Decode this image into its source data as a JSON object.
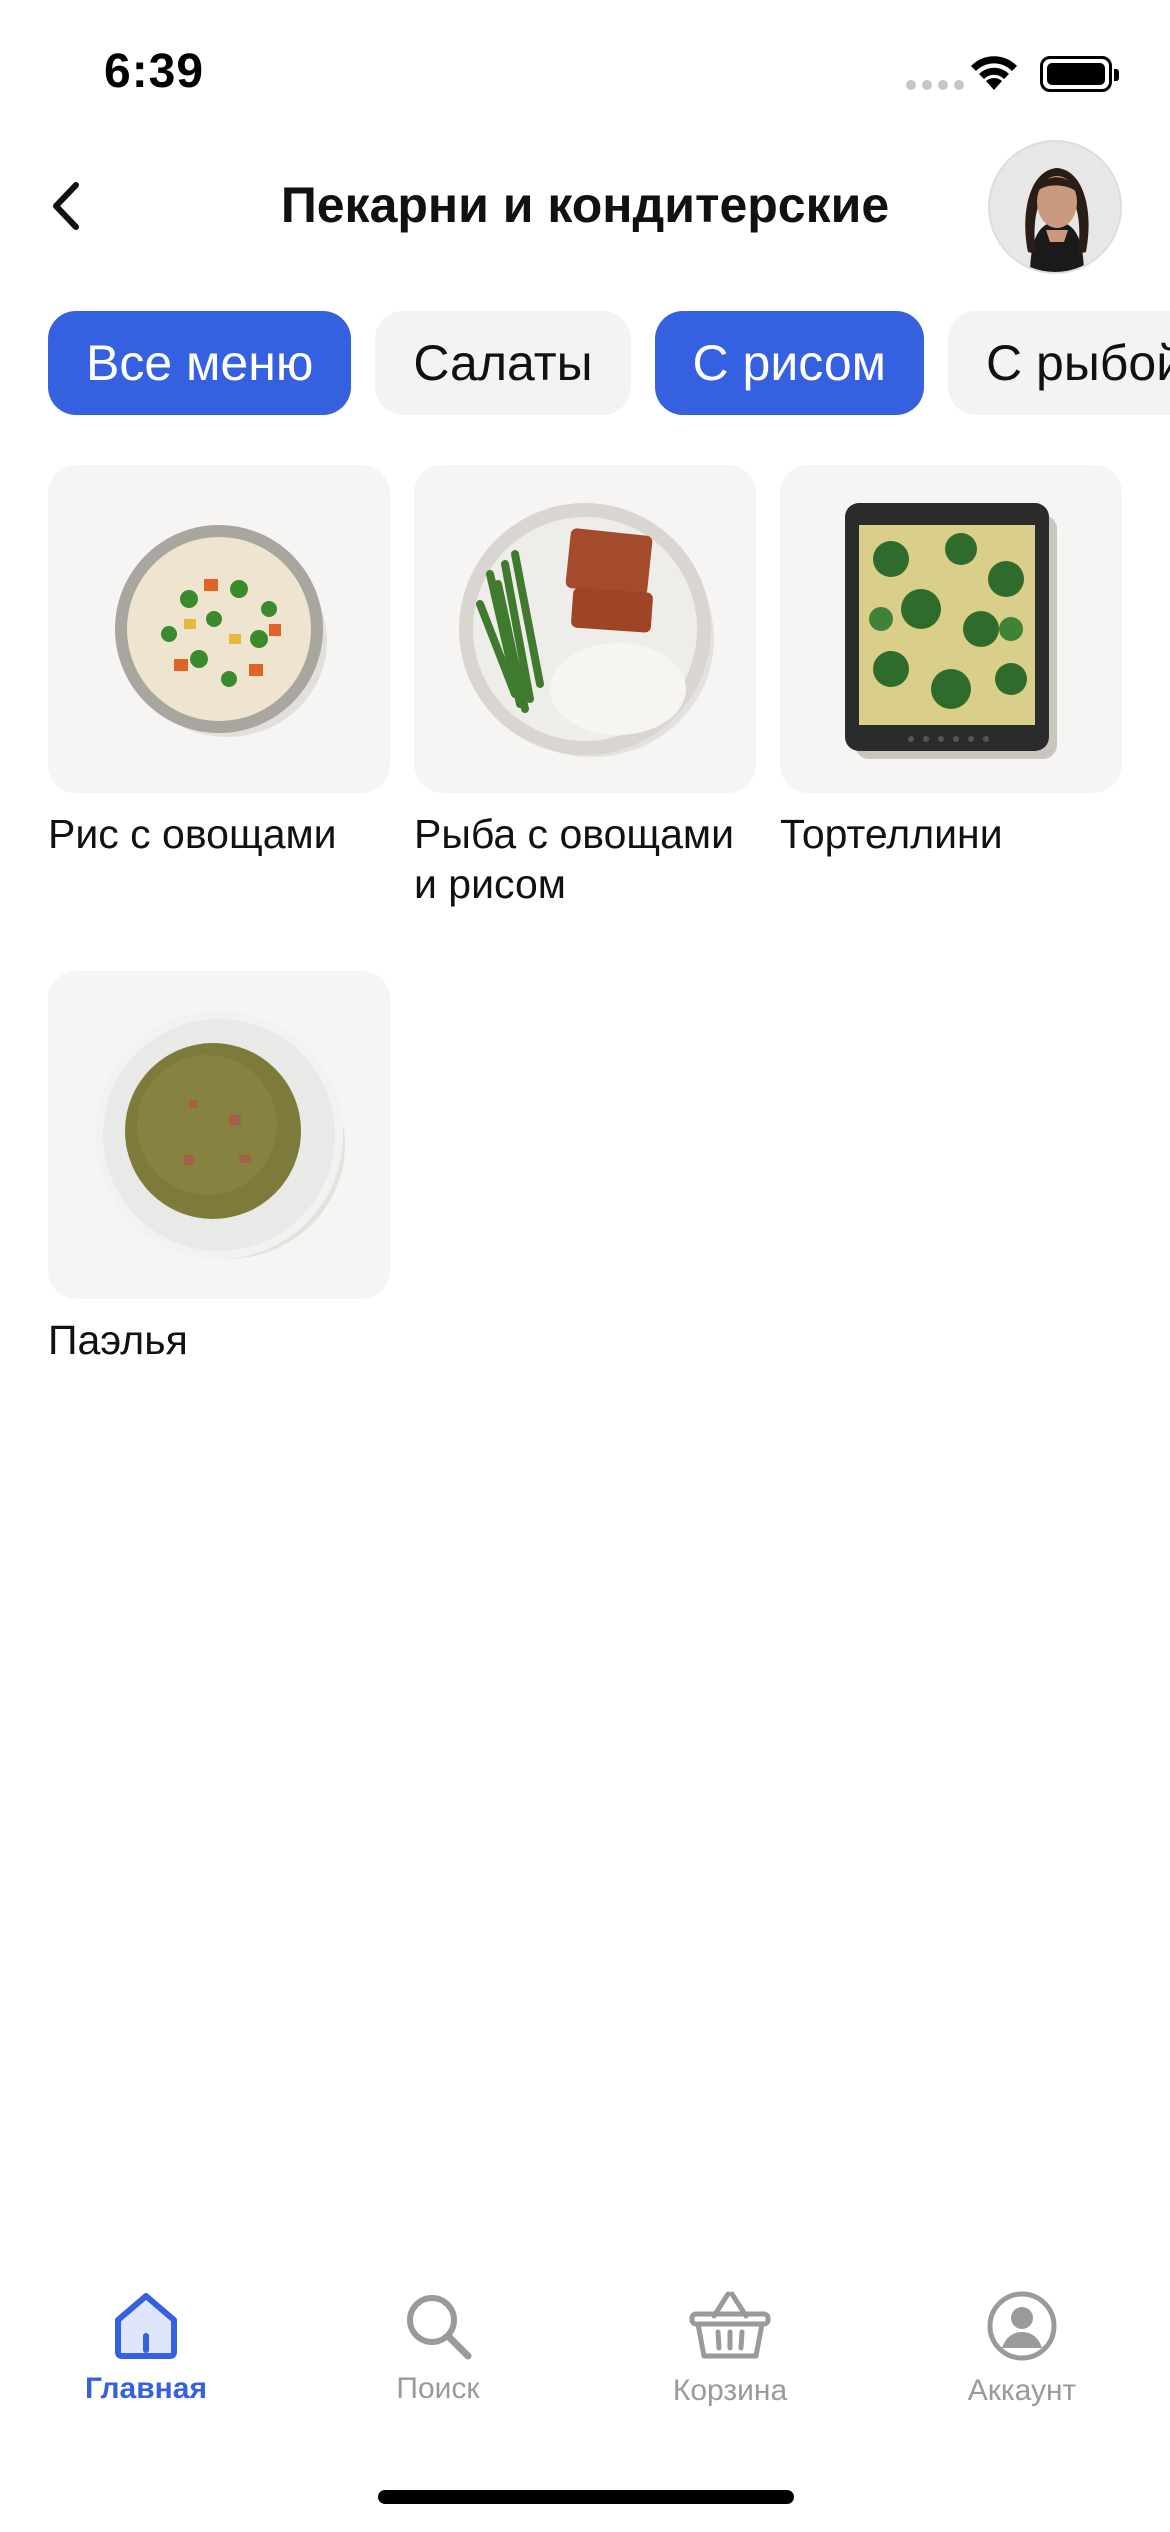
{
  "status": {
    "time": "6:39"
  },
  "header": {
    "title": "Пекарни и кондитерские"
  },
  "chips": [
    {
      "label": "Все меню",
      "active": true
    },
    {
      "label": "Салаты",
      "active": false
    },
    {
      "label": "С рисом",
      "active": true
    },
    {
      "label": "С рыбой",
      "active": false
    }
  ],
  "items": [
    {
      "name": "Рис с овощами"
    },
    {
      "name": "Рыба с овощами и рисом"
    },
    {
      "name": "Тортеллини"
    },
    {
      "name": "Паэлья"
    }
  ],
  "tabbar": {
    "tabs": [
      {
        "label": "Главная",
        "icon": "home-icon",
        "active": true
      },
      {
        "label": "Поиск",
        "icon": "search-icon",
        "active": false
      },
      {
        "label": "Корзина",
        "icon": "basket-icon",
        "active": false
      },
      {
        "label": "Аккаунт",
        "icon": "account-icon",
        "active": false
      }
    ]
  },
  "colors": {
    "accent": "#3561e0",
    "chip_inactive": "#f4f3f1",
    "card_bg": "#f6f5f3",
    "tab_inactive": "#9a9a9a"
  }
}
